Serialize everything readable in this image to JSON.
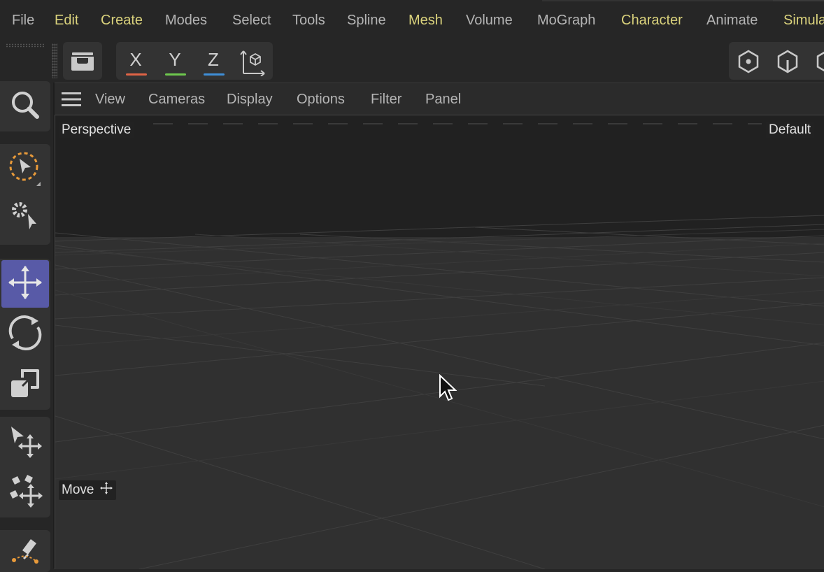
{
  "menubar": {
    "items": [
      {
        "label": "File",
        "highlighted": false
      },
      {
        "label": "Edit",
        "highlighted": true
      },
      {
        "label": "Create",
        "highlighted": true
      },
      {
        "label": "Modes",
        "highlighted": false
      },
      {
        "label": "Select",
        "highlighted": false
      },
      {
        "label": "Tools",
        "highlighted": false
      },
      {
        "label": "Spline",
        "highlighted": false
      },
      {
        "label": "Mesh",
        "highlighted": true
      },
      {
        "label": "Volume",
        "highlighted": false
      },
      {
        "label": "MoGraph",
        "highlighted": false
      },
      {
        "label": "Character",
        "highlighted": true
      },
      {
        "label": "Animate",
        "highlighted": false
      },
      {
        "label": "Simula",
        "highlighted": true
      }
    ]
  },
  "toolbar": {
    "make_editable_icon": "archive-icon",
    "axis_x": {
      "label": "X",
      "color": "#e06446"
    },
    "axis_y": {
      "label": "Y",
      "color": "#6ec84e"
    },
    "axis_z": {
      "label": "Z",
      "color": "#3f8fd8"
    },
    "coordinate_system_icon": "world-coordinate-icon",
    "right_icons": [
      "points-mode-icon",
      "edges-mode-icon",
      "polygons-mode-icon"
    ]
  },
  "left_toolbar": {
    "tools": [
      {
        "icon": "search-icon",
        "active": false
      },
      {
        "icon": "live-selection-icon",
        "active": false
      },
      {
        "icon": "tweak-icon",
        "active": false
      },
      {
        "icon": "move-icon",
        "active": true
      },
      {
        "icon": "rotate-icon",
        "active": false
      },
      {
        "icon": "scale-icon",
        "active": false
      },
      {
        "icon": "move-arrow-icon",
        "active": false
      },
      {
        "icon": "cloner-move-icon",
        "active": false
      },
      {
        "icon": "pen-icon",
        "active": false
      }
    ],
    "accent_color": "#585aa7"
  },
  "viewport": {
    "menu": [
      "View",
      "Cameras",
      "Display",
      "Options",
      "Filter",
      "Panel"
    ],
    "camera_label": "Perspective",
    "display_label": "Default",
    "tool_label": "Move"
  }
}
